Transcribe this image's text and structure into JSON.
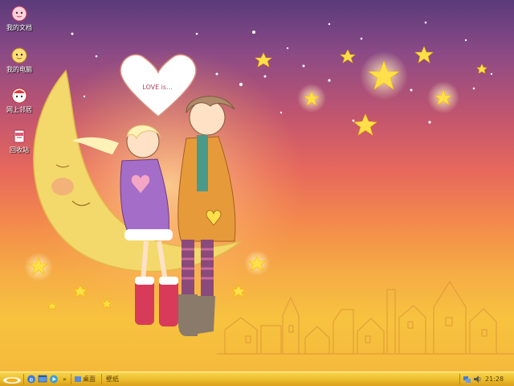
{
  "desktop": {
    "icons": [
      {
        "label": "我的文档",
        "icon": "my-documents-icon"
      },
      {
        "label": "我的电脑",
        "icon": "my-computer-icon"
      },
      {
        "label": "网上邻居",
        "icon": "network-places-icon"
      },
      {
        "label": "回收站",
        "icon": "recycle-bin-icon"
      }
    ],
    "wallpaper": {
      "heart_text": "LOVE is...",
      "colors": {
        "sky_top": "#5a3a7a",
        "sky_bottom": "#f5b93a",
        "moon": "#f3d96b",
        "star": "#ffe04a"
      }
    }
  },
  "taskbar": {
    "start_icon": "start-logo-icon",
    "quick_launch": [
      "ie-icon",
      "show-desktop-icon",
      "media-player-icon"
    ],
    "expand_label": "»",
    "toolbar_desktop_label": "桌面",
    "toolbar_wallpaper_label": "壁纸",
    "tray_icons": [
      "network-icon",
      "volume-icon"
    ],
    "clock": "21:28",
    "colors": {
      "bar": "#e9b92b"
    }
  }
}
